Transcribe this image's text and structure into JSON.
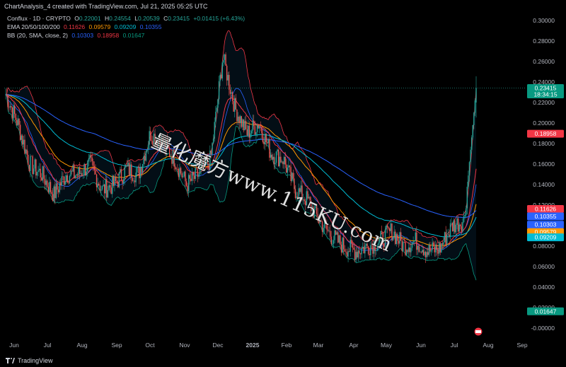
{
  "caption": "ChartAnalysis_4 created with TradingView.com, Jul 21, 2025 05:25 UTC",
  "legend": {
    "symbol": "Conflux · 1D · CRYPTO",
    "o_label": "O",
    "o_value": "0.22001",
    "h_label": "H",
    "h_value": "0.24554",
    "l_label": "L",
    "l_value": "0.20539",
    "c_label": "C",
    "c_value": "0.23415",
    "change": "+0.01415 (+6.43%)",
    "ema_label": "EMA 20/50/100/200",
    "ema20": "0.11626",
    "ema50": "0.09579",
    "ema100": "0.09209",
    "ema200": "0.10355",
    "bb_label": "BB (20, SMA, close, 2)",
    "bb_basis": "0.10303",
    "bb_upper": "0.18958",
    "bb_lower": "0.01647"
  },
  "brand": "TradingView",
  "watermark": "量化魔方www.115KU.com",
  "colors": {
    "background": "#000000",
    "up": "#26a69a",
    "down": "#ef5350",
    "ema20": "#f23645",
    "ema50": "#ff9800",
    "ema100": "#00bcd4",
    "ema200": "#2962ff",
    "bb_basis": "#2962ff",
    "bb_upper": "#f23645",
    "bb_lower": "#089981",
    "bb_fill": "#2196f3"
  },
  "chart_data": {
    "type": "candlestick",
    "symbol": "Conflux",
    "interval": "1D",
    "x_axis_labels": [
      "Jun",
      "Jul",
      "Aug",
      "Sep",
      "Oct",
      "Nov",
      "Dec",
      "2025",
      "Feb",
      "Mar",
      "Apr",
      "May",
      "Jun",
      "Jul",
      "Aug",
      "Sep"
    ],
    "y_axis_labels": [
      "0.30000",
      "0.28000",
      "0.26000",
      "0.24000",
      "0.22000",
      "0.20000",
      "0.18000",
      "0.16000",
      "0.14000",
      "0.12000",
      "0.10000",
      "0.08000",
      "0.06000",
      "0.04000",
      "0.02000",
      "-0.00000"
    ],
    "ylim": [
      -0.004,
      0.302
    ],
    "scale": "linear",
    "price_tags": [
      {
        "value": 0.23415,
        "label": "0.23415",
        "sublabel": "18:34:15",
        "color": "#089981"
      },
      {
        "value": 0.18958,
        "label": "0.18958",
        "color": "#f23645"
      },
      {
        "value": 0.11626,
        "label": "0.11626",
        "color": "#f23645"
      },
      {
        "value": 0.10355,
        "label": "0.10355",
        "color": "#2962ff"
      },
      {
        "value": 0.10303,
        "label": "0.10303",
        "color": "#2962ff"
      },
      {
        "value": 0.09579,
        "label": "0.09579",
        "color": "#ff9800"
      },
      {
        "value": 0.09209,
        "label": "0.09209",
        "color": "#00bcd4"
      },
      {
        "value": 0.01647,
        "label": "0.01647",
        "color": "#089981"
      }
    ],
    "close_anchors": [
      [
        "Jun",
        0.228
      ],
      [
        "Jun",
        0.2
      ],
      [
        "Jun",
        0.16
      ],
      [
        "Jul",
        0.15
      ],
      [
        "Jul",
        0.13
      ],
      [
        "Jul",
        0.15
      ],
      [
        "Aug",
        0.15
      ],
      [
        "Aug",
        0.16
      ],
      [
        "Aug",
        0.135
      ],
      [
        "Sep",
        0.14
      ],
      [
        "Sep",
        0.155
      ],
      [
        "Sep",
        0.15
      ],
      [
        "Oct",
        0.19
      ],
      [
        "Oct",
        0.18
      ],
      [
        "Oct",
        0.165
      ],
      [
        "Nov",
        0.14
      ],
      [
        "Nov",
        0.15
      ],
      [
        "Nov",
        0.165
      ],
      [
        "Dec",
        0.265
      ],
      [
        "Dec",
        0.215
      ],
      [
        "Dec",
        0.19
      ],
      [
        "2025",
        0.2
      ],
      [
        "2025",
        0.17
      ],
      [
        "2025",
        0.165
      ],
      [
        "Feb",
        0.135
      ],
      [
        "Feb",
        0.125
      ],
      [
        "Mar",
        0.105
      ],
      [
        "Mar",
        0.09
      ],
      [
        "Mar",
        0.08
      ],
      [
        "Apr",
        0.075
      ],
      [
        "Apr",
        0.08
      ],
      [
        "May",
        0.085
      ],
      [
        "May",
        0.095
      ],
      [
        "May",
        0.08
      ],
      [
        "Jun",
        0.085
      ],
      [
        "Jun",
        0.075
      ],
      [
        "Jun",
        0.078
      ],
      [
        "Jul",
        0.1
      ],
      [
        "Jul",
        0.105
      ],
      [
        "Jul",
        0.234
      ]
    ],
    "last_candle": {
      "open": 0.22001,
      "high": 0.24554,
      "low": 0.20539,
      "close": 0.23415
    },
    "indicators": {
      "ema": {
        "periods": [
          20,
          50,
          100,
          200
        ],
        "values": [
          0.11626,
          0.09579,
          0.09209,
          0.10355
        ]
      },
      "bollinger": {
        "length": 20,
        "ma": "SMA",
        "source": "close",
        "mult": 2,
        "basis": 0.10303,
        "upper": 0.18958,
        "lower": 0.01647
      }
    },
    "grid": false,
    "legend_position": "top-left"
  }
}
